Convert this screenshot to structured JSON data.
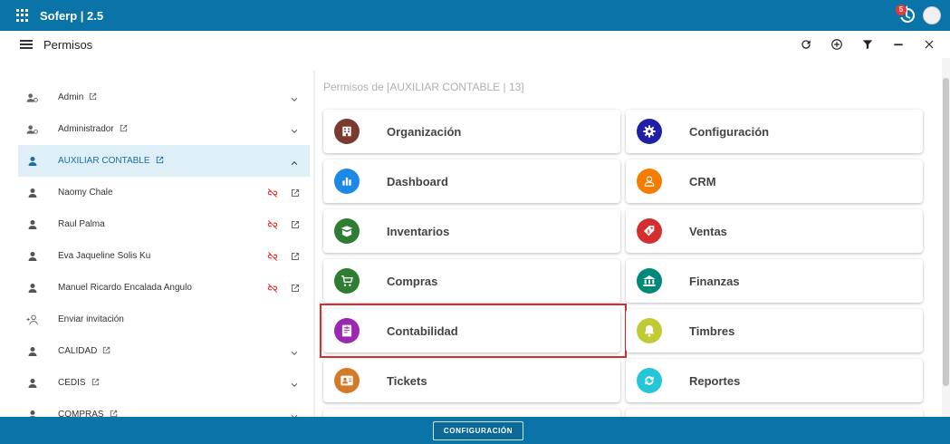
{
  "app": {
    "title": "Soferp | 2.5",
    "notification_count": "5"
  },
  "toolbar": {
    "page_title": "Permisos"
  },
  "users": [
    {
      "name": "Admin",
      "icon": "group-user-icon",
      "has_link": true,
      "expandable": true,
      "expanded": false
    },
    {
      "name": "Administrador",
      "icon": "group-user-icon",
      "has_link": true,
      "expandable": true,
      "expanded": false
    },
    {
      "name": "AUXILIAR CONTABLE",
      "icon": "person-icon",
      "has_link": true,
      "expandable": true,
      "expanded": true,
      "selected": true
    },
    {
      "name": "Naomy Chale",
      "icon": "person-icon",
      "member": true
    },
    {
      "name": "Raul Palma",
      "icon": "person-icon",
      "member": true
    },
    {
      "name": "Eva Jaqueline Solis Ku",
      "icon": "person-icon",
      "member": true
    },
    {
      "name": "Manuel Ricardo Encalada Angulo",
      "icon": "person-icon",
      "member": true
    },
    {
      "name": "Enviar invitación",
      "icon": "person-add-icon"
    },
    {
      "name": "CALIDAD",
      "icon": "person-icon",
      "has_link": true,
      "expandable": true,
      "expanded": false
    },
    {
      "name": "CEDIS",
      "icon": "person-icon",
      "has_link": true,
      "expandable": true,
      "expanded": false
    },
    {
      "name": "COMPRAS",
      "icon": "person-icon",
      "has_link": true,
      "expandable": true,
      "expanded": false
    }
  ],
  "permissions": {
    "subtitle": "Permisos de [AUXILIAR CONTABLE | 13]",
    "modules": [
      {
        "label": "Organización",
        "icon": "building-icon",
        "color": "#7b3a30"
      },
      {
        "label": "Configuración",
        "icon": "gear-icon",
        "color": "#1f1fa8"
      },
      {
        "label": "Dashboard",
        "icon": "bar-chart-icon",
        "color": "#1e88e5"
      },
      {
        "label": "CRM",
        "icon": "crm-person-icon",
        "color": "#f57c00"
      },
      {
        "label": "Inventarios",
        "icon": "box-icon",
        "color": "#2e7d32"
      },
      {
        "label": "Ventas",
        "icon": "price-tag-icon",
        "color": "#d32f2f"
      },
      {
        "label": "Compras",
        "icon": "cart-icon",
        "color": "#2e7d32"
      },
      {
        "label": "Finanzas",
        "icon": "bank-icon",
        "color": "#00897b"
      },
      {
        "label": "Contabilidad",
        "icon": "ledger-icon",
        "color": "#9c27b0",
        "highlighted": true
      },
      {
        "label": "Timbres",
        "icon": "bell-icon",
        "color": "#c0ca33"
      },
      {
        "label": "Tickets",
        "icon": "ticket-icon",
        "color": "#d4782a"
      },
      {
        "label": "Reportes",
        "icon": "report-icon",
        "color": "#26c6da"
      }
    ]
  },
  "footer": {
    "button_label": "CONFIGURACIÓN"
  }
}
